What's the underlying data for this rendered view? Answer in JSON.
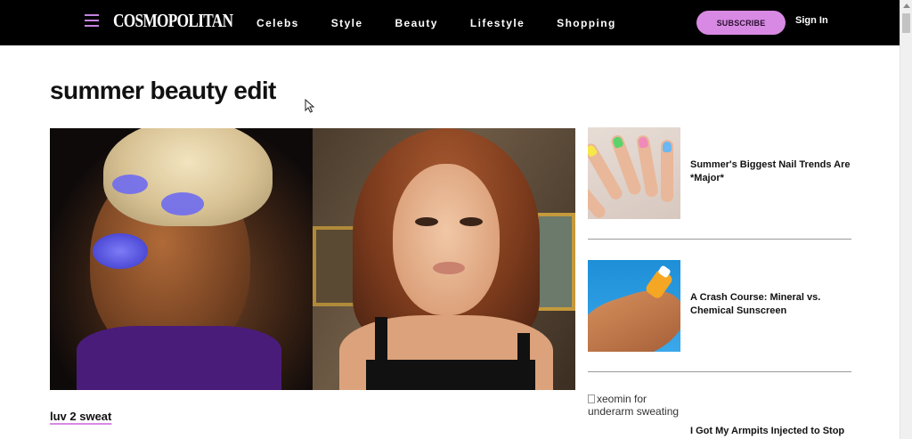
{
  "header": {
    "logo": "COSMOPOLITAN",
    "nav": [
      "Celebs",
      "Style",
      "Beauty",
      "Lifestyle",
      "Shopping"
    ],
    "subscribe_label": "SUBSCRIBE",
    "signin_label": "Sign In"
  },
  "page": {
    "title": "summer beauty edit"
  },
  "hero": {
    "caption": "luv 2 sweat"
  },
  "cards": [
    {
      "title": "Summer's Biggest Nail Trends Are *Major*"
    },
    {
      "title": "A Crash Course: Mineral vs. Chemical Sunscreen"
    },
    {
      "title": "I Got My Armpits Injected to Stop",
      "image_alt": "xeomin for underarm sweating"
    }
  ],
  "colors": {
    "accent": "#d889e3",
    "header_bg": "#000000",
    "hamburger": "#c582e0"
  }
}
